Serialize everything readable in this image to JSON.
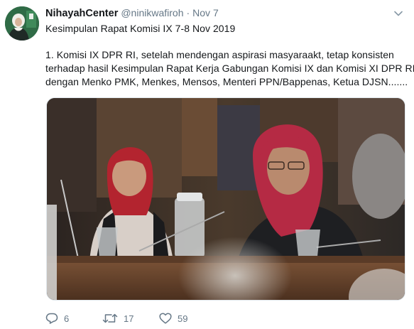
{
  "tweet": {
    "display_name": "NihayahCenter",
    "handle": "@ninikwafiroh",
    "separator": "·",
    "timestamp": "Nov 7",
    "text_lines": [
      "Kesimpulan Rapat Komisi IX 7-8 Nov 2019",
      "1. Komisi IX DPR RI, setelah mendengan aspirasi masyaraakt, tetap konsisten",
      "terhadap hasil Kesimpulan Rapat Kerja Gabungan Komisi IX dan Komisi XI DPR RI,",
      "dengan Menko PMK, Menkes, Mensos, Menteri PPN/Bappenas, Ketua DJSN......."
    ]
  },
  "actions": {
    "reply_count": "6",
    "retweet_count": "17",
    "like_count": "59"
  },
  "icons": {
    "caret": "chevron-down-icon",
    "reply": "reply-icon",
    "retweet": "retweet-icon",
    "like": "heart-icon"
  },
  "colors": {
    "text": "#14171a",
    "secondary": "#657786",
    "avatar_bg": "#2f6b46"
  }
}
